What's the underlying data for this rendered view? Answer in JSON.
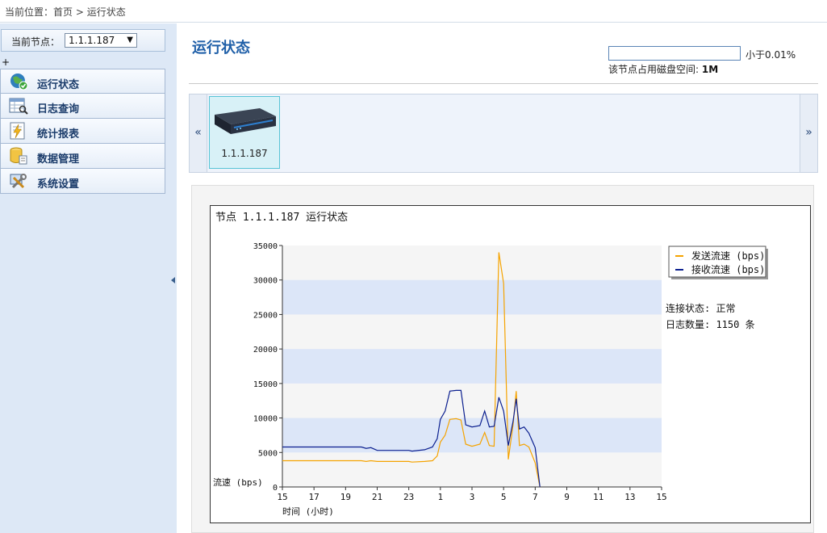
{
  "breadcrumb": {
    "prefix": "当前位置：",
    "home": "首页",
    "sep": " > ",
    "current": "运行状态"
  },
  "sidebar": {
    "node_label": "当前节点：",
    "node_value": "1.1.1.187",
    "plus": "+",
    "items": [
      {
        "label": "运行状态",
        "icon": "globe-check-icon"
      },
      {
        "label": "日志查询",
        "icon": "table-search-icon"
      },
      {
        "label": "统计报表",
        "icon": "report-bolt-icon"
      },
      {
        "label": "数据管理",
        "icon": "database-icon"
      },
      {
        "label": "系统设置",
        "icon": "tools-icon"
      }
    ]
  },
  "main": {
    "title": "运行状态",
    "disk": {
      "percent_text": "小于0.01%",
      "usage_label": "该节点占用磁盘空间:",
      "usage_value": "1M"
    },
    "carousel": {
      "prev": "«",
      "next": "»",
      "items": [
        {
          "label": "1.1.1.187",
          "icon": "server-device-icon"
        }
      ]
    }
  },
  "status": {
    "connection": "连接状态: 正常",
    "log_count": "日志数量: 1150 条"
  },
  "colors": {
    "send": "#f5a300",
    "recv": "#0b1f8f",
    "band": "#dce6f8",
    "accent": "#1f5fa8"
  },
  "chart_data": {
    "type": "line",
    "title": "节点 1.1.1.187 运行状态",
    "xlabel": "时间 (小时)",
    "ylabel": "流速 (bps)",
    "ylim": [
      0,
      35000
    ],
    "yticks": [
      0,
      5000,
      10000,
      15000,
      20000,
      25000,
      30000,
      35000
    ],
    "xticks": [
      "15",
      "17",
      "19",
      "21",
      "23",
      "1",
      "3",
      "5",
      "7",
      "9",
      "11",
      "13",
      "15"
    ],
    "legend_position": "top-right",
    "grid": "alternating horizontal bands",
    "series": [
      {
        "name": "发送流速 (bps)",
        "points": [
          [
            15,
            3800
          ],
          [
            16,
            3800
          ],
          [
            17,
            3800
          ],
          [
            18,
            3800
          ],
          [
            19,
            3800
          ],
          [
            20,
            3800
          ],
          [
            20.3,
            3700
          ],
          [
            20.6,
            3800
          ],
          [
            21,
            3700
          ],
          [
            22,
            3700
          ],
          [
            23,
            3700
          ],
          [
            23.2,
            3600
          ],
          [
            24,
            3700
          ],
          [
            24.5,
            3800
          ],
          [
            24.8,
            4500
          ],
          [
            25,
            6500
          ],
          [
            25.3,
            7500
          ],
          [
            25.6,
            9800
          ],
          [
            26,
            9900
          ],
          [
            26.3,
            9700
          ],
          [
            26.6,
            6200
          ],
          [
            27,
            5900
          ],
          [
            27.5,
            6200
          ],
          [
            27.8,
            7900
          ],
          [
            28.1,
            6000
          ],
          [
            28.4,
            5900
          ],
          [
            28.7,
            34000
          ],
          [
            29,
            29500
          ],
          [
            29.3,
            4000
          ],
          [
            29.6,
            9000
          ],
          [
            29.8,
            13900
          ],
          [
            30,
            6000
          ],
          [
            30.3,
            6200
          ],
          [
            30.6,
            5800
          ],
          [
            31,
            3500
          ],
          [
            31.3,
            0
          ]
        ]
      },
      {
        "name": "接收流速 (bps)",
        "points": [
          [
            15,
            5800
          ],
          [
            16,
            5800
          ],
          [
            17,
            5800
          ],
          [
            18,
            5800
          ],
          [
            19,
            5800
          ],
          [
            20,
            5800
          ],
          [
            20.3,
            5600
          ],
          [
            20.6,
            5700
          ],
          [
            21,
            5300
          ],
          [
            22,
            5300
          ],
          [
            23,
            5300
          ],
          [
            23.2,
            5200
          ],
          [
            24,
            5400
          ],
          [
            24.5,
            5800
          ],
          [
            24.8,
            7000
          ],
          [
            25,
            9800
          ],
          [
            25.3,
            11000
          ],
          [
            25.6,
            13900
          ],
          [
            26,
            14000
          ],
          [
            26.3,
            14000
          ],
          [
            26.6,
            9000
          ],
          [
            27,
            8700
          ],
          [
            27.5,
            8900
          ],
          [
            27.8,
            11000
          ],
          [
            28.1,
            8700
          ],
          [
            28.4,
            8800
          ],
          [
            28.7,
            13000
          ],
          [
            29,
            11000
          ],
          [
            29.3,
            6000
          ],
          [
            29.6,
            9500
          ],
          [
            29.8,
            12800
          ],
          [
            30,
            8400
          ],
          [
            30.3,
            8700
          ],
          [
            30.6,
            7800
          ],
          [
            31,
            5700
          ],
          [
            31.3,
            0
          ]
        ]
      }
    ]
  }
}
